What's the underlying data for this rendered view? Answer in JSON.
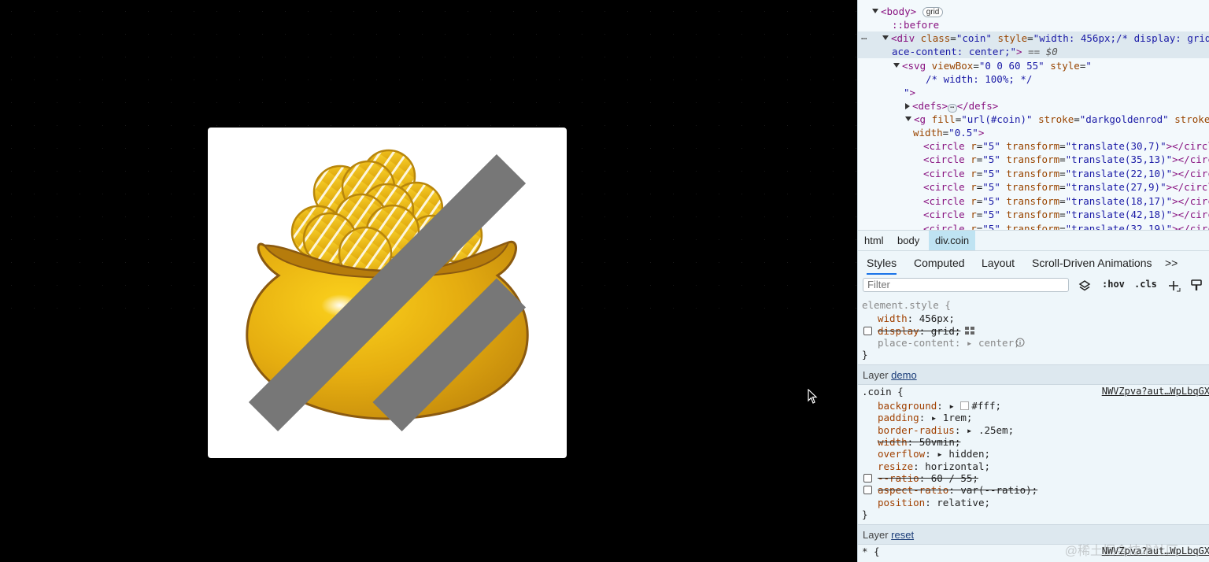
{
  "dom": {
    "lines": [
      {
        "indent": 0,
        "text": "▼ <body>",
        "badge": "grid"
      },
      {
        "text": "::before"
      },
      {
        "text": "▼ <div class=\"coin\" style=\"width: 456px;/* display: grid;",
        "prefix": "…"
      },
      {
        "text": "ace-content: center;\"> == $0"
      },
      {
        "text": "▼ <svg viewBox=\"0 0 60 55\" style=\""
      },
      {
        "text": "/* width: 100%; */"
      },
      {
        "text": "\">"
      },
      {
        "text": "▶ <defs> … </defs>"
      },
      {
        "text": "▼ <g fill=\"url(#coin)\" stroke=\"darkgoldenrod\" stroke-"
      },
      {
        "text": "width=\"0.5\">"
      },
      {
        "text": "<circle r=\"5\" transform=\"translate(30,7)\"></circle"
      },
      {
        "text": "<circle r=\"5\" transform=\"translate(35,13)\"></circl"
      },
      {
        "text": "<circle r=\"5\" transform=\"translate(22,10)\"></circl"
      },
      {
        "text": "<circle r=\"5\" transform=\"translate(27,9)\"></circle"
      },
      {
        "text": "<circle r=\"5\" transform=\"translate(18,17)\"></circl"
      },
      {
        "text": "<circle r=\"5\" transform=\"translate(42,18)\"></circl"
      },
      {
        "text": "<circle r=\"5\" transform=\"translate(32,19)\"></circl"
      }
    ]
  },
  "breadcrumbs": [
    "html",
    "body",
    "div.coin"
  ],
  "tabs": [
    "Styles",
    "Computed",
    "Layout",
    "Scroll-Driven Animations",
    ">>"
  ],
  "filter": {
    "placeholder": "Filter",
    "hov": ":hov",
    "cls": ".cls"
  },
  "element_style": {
    "selector": "element.style {",
    "width_prop": "width",
    "width_val": "456px;",
    "display_prop": "display",
    "display_val": "grid;",
    "place_prop": "place-content",
    "place_val": "center;",
    "close": "}"
  },
  "layer_demo": {
    "label": "Layer",
    "name": "demo"
  },
  "coin_rule": {
    "selector": ".coin {",
    "source": "NWVZpva?aut…WpLbqGX",
    "props": [
      {
        "p": "background",
        "v": "#fff;"
      },
      {
        "p": "padding",
        "v": "1rem;"
      },
      {
        "p": "border-radius",
        "v": ".25em;"
      },
      {
        "p": "width",
        "v": "50vmin;"
      },
      {
        "p": "overflow",
        "v": "hidden;"
      },
      {
        "p": "resize",
        "v": "horizontal;"
      },
      {
        "p": "--ratio",
        "v": "60 / 55;"
      },
      {
        "p": "aspect-ratio",
        "v": "var(--ratio);"
      },
      {
        "p": "position",
        "v": "relative;"
      }
    ],
    "close": "}"
  },
  "layer_reset": {
    "label": "Layer",
    "name": "reset"
  },
  "reset_rule": {
    "selector": "* {",
    "source": "NWVZpva?aut…WpLbqGX"
  },
  "watermark": "@稀土掘金技术社区",
  "colors": {
    "coin_fill": "#f5c71a",
    "stroke": "#b8860b",
    "pot": "#e6b012",
    "pot_stroke": "#8b5a10"
  }
}
